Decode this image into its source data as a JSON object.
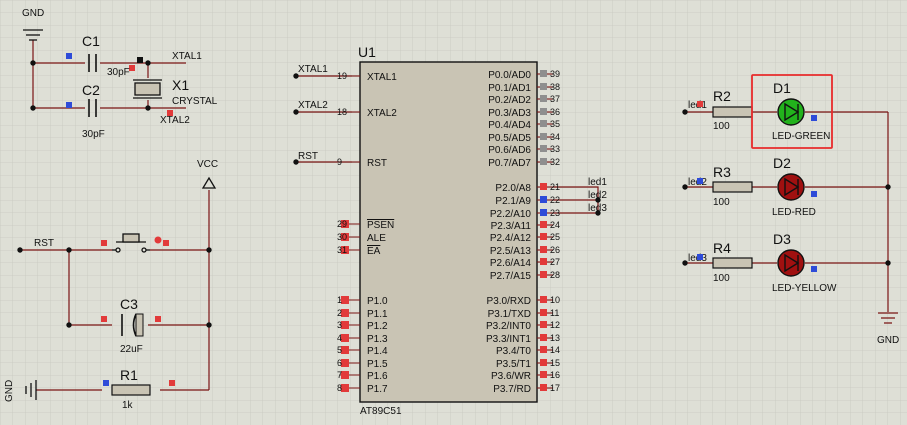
{
  "colors": {
    "background": "#dedfd6",
    "grid": "#c8c9bf",
    "wire": "#7a1414",
    "chip_fill": "#c9c4b4",
    "led_fill": "#a01010",
    "led_green": "#22b21c",
    "highlight": "#e82b2b",
    "pin_square_blue": "#2e4bd8",
    "pin_square_red": "#e23a3a"
  },
  "labels": {
    "gnd_top": "GND",
    "c1_ref": "C1",
    "c1_val": "30pF",
    "c2_ref": "C2",
    "c2_val": "30pF",
    "x1_ref": "X1",
    "x1_val": "CRYSTAL",
    "xtal1_net": "XTAL1",
    "xtal2_net": "XTAL2",
    "vcc": "VCC",
    "rst_net": "RST",
    "c3_ref": "C3",
    "c3_val": "22uF",
    "gnd_left": "GND",
    "r1_ref": "R1",
    "r1_val": "1k",
    "u1_ref": "U1",
    "u1_part": "AT89C51",
    "net_xtal1": "XTAL1",
    "net_xtal2": "XTAL2",
    "net_rst": "RST",
    "pin19": "19",
    "pin18": "18",
    "pin9": "9",
    "led1_net": "led1",
    "led2_net": "led2",
    "led3_net": "led3",
    "r2_ref": "R2",
    "r2_val": "100",
    "r3_ref": "R3",
    "r3_val": "100",
    "r4_ref": "R4",
    "r4_val": "100",
    "d1_ref": "D1",
    "d1_val": "LED-GREEN",
    "d2_ref": "D2",
    "d2_val": "LED-RED",
    "d3_ref": "D3",
    "d3_val": "LED-YELLOW",
    "gnd_right": "GND"
  },
  "u1": {
    "left_pins": [
      {
        "num": "19",
        "name": "XTAL1"
      },
      {
        "num": "18",
        "name": "XTAL2"
      },
      {
        "num": "9",
        "name": "RST"
      },
      {
        "num": "29",
        "name": "PSEN"
      },
      {
        "num": "30",
        "name": "ALE"
      },
      {
        "num": "31",
        "name": "EA"
      },
      {
        "num": "1",
        "name": "P1.0"
      },
      {
        "num": "2",
        "name": "P1.1"
      },
      {
        "num": "3",
        "name": "P1.2"
      },
      {
        "num": "4",
        "name": "P1.3"
      },
      {
        "num": "5",
        "name": "P1.4"
      },
      {
        "num": "6",
        "name": "P1.5"
      },
      {
        "num": "7",
        "name": "P1.6"
      },
      {
        "num": "8",
        "name": "P1.7"
      }
    ],
    "right_pins": [
      {
        "num": "39",
        "name": "P0.0/AD0"
      },
      {
        "num": "38",
        "name": "P0.1/AD1"
      },
      {
        "num": "37",
        "name": "P0.2/AD2"
      },
      {
        "num": "36",
        "name": "P0.3/AD3"
      },
      {
        "num": "35",
        "name": "P0.4/AD4"
      },
      {
        "num": "34",
        "name": "P0.5/AD5"
      },
      {
        "num": "33",
        "name": "P0.6/AD6"
      },
      {
        "num": "32",
        "name": "P0.7/AD7"
      },
      {
        "num": "21",
        "name": "P2.0/A8"
      },
      {
        "num": "22",
        "name": "P2.1/A9"
      },
      {
        "num": "23",
        "name": "P2.2/A10"
      },
      {
        "num": "24",
        "name": "P2.3/A11"
      },
      {
        "num": "25",
        "name": "P2.4/A12"
      },
      {
        "num": "26",
        "name": "P2.5/A13"
      },
      {
        "num": "27",
        "name": "P2.6/A14"
      },
      {
        "num": "28",
        "name": "P2.7/A15"
      },
      {
        "num": "10",
        "name": "P3.0/RXD"
      },
      {
        "num": "11",
        "name": "P3.1/TXD"
      },
      {
        "num": "12",
        "name": "P3.2/INT0"
      },
      {
        "num": "13",
        "name": "P3.3/INT1"
      },
      {
        "num": "14",
        "name": "P3.4/T0"
      },
      {
        "num": "15",
        "name": "P3.5/T1"
      },
      {
        "num": "16",
        "name": "P3.6/WR"
      },
      {
        "num": "17",
        "name": "P3.7/RD"
      }
    ],
    "port2_nets": [
      "led1",
      "led2",
      "led3"
    ]
  }
}
